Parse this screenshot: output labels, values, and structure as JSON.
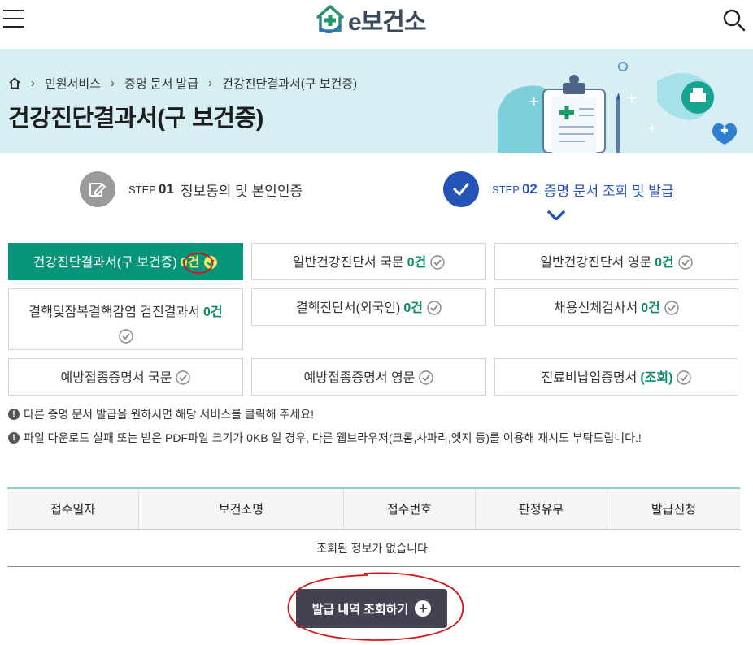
{
  "header": {
    "logo_text": "e보건소",
    "menu_icon": "hamburger-menu-icon",
    "search_icon": "search-icon"
  },
  "breadcrumb": {
    "home_icon": "home-icon",
    "items": [
      "민원서비스",
      "증명 문서 발급",
      "건강진단결과서(구 보건증)"
    ]
  },
  "page_title": "건강진단결과서(구 보건증)",
  "steps": [
    {
      "kicker": "STEP",
      "num": "01",
      "label": "정보동의 및 본인인증",
      "icon": "pencil-edit-icon",
      "active": false
    },
    {
      "kicker": "STEP",
      "num": "02",
      "label": "증명 문서 조회 및 발급",
      "icon": "checkmark-icon",
      "active": true
    }
  ],
  "documents": [
    {
      "label": "건강진단결과서(구 보건증)",
      "count": "0건",
      "active": true
    },
    {
      "label": "일반건강진단서 국문",
      "count": "0건",
      "active": false
    },
    {
      "label": "일반건강진단서 영문",
      "count": "0건",
      "active": false
    },
    {
      "label": "결핵및잠복결핵감염 검진결과서",
      "count": "0건",
      "active": false
    },
    {
      "label": "결핵진단서(외국인)",
      "count": "0건",
      "active": false
    },
    {
      "label": "채용신체검사서",
      "count": "0건",
      "active": false
    },
    {
      "label": "예방접종증명서 국문",
      "count": "",
      "active": false
    },
    {
      "label": "예방접종증명서 영문",
      "count": "",
      "active": false
    },
    {
      "label": "진료비납입증명서",
      "count": "(조회)",
      "active": false
    }
  ],
  "notices": [
    "다른 증명 문서 발급을 원하시면 해당 서비스를 클릭해 주세요!",
    "파일 다운로드 실패 또는 받은 PDF파일 크기가 0KB 일 경우, 다른 웹브라우저(크롬,사파리,엣지 등)를 이용해 재시도 부탁드립니다.!"
  ],
  "table": {
    "columns": [
      "접수일자",
      "보건소명",
      "접수번호",
      "판정유무",
      "발급신청"
    ],
    "empty_message": "조회된 정보가 없습니다."
  },
  "history_button": {
    "label": "발급 내역 조회하기",
    "icon": "plus-circle-icon"
  },
  "colors": {
    "accent_green": "#07957a",
    "count_green": "#0a8a6c",
    "active_count": "#f4e76a",
    "step_blue": "#2653b7",
    "banner_bg": "#d7eff3",
    "button_dark": "#424252",
    "annotation_red": "#d01818"
  }
}
